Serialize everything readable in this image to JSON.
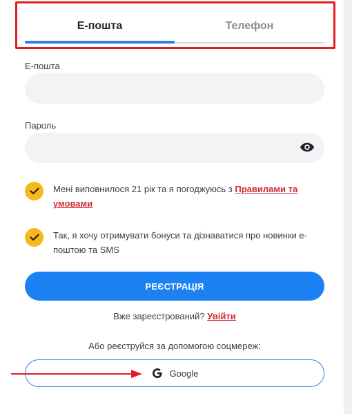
{
  "tabs": {
    "email_label": "Е-пошта",
    "phone_label": "Телефон",
    "active": "email"
  },
  "form": {
    "email_label": "Е-пошта",
    "email_value": "",
    "password_label": "Пароль",
    "password_value": "",
    "password_toggle_icon": "eye-icon"
  },
  "consents": [
    {
      "checked": true,
      "text": "Мені виповнилося 21 рік та я погоджуюсь з ",
      "link": "Правилами та умовами"
    },
    {
      "checked": true,
      "text": "Так, я хочу отримувати бонуси та дізнаватися про новинки е-поштою та SMS"
    }
  ],
  "register_button": "РЕЄСТРАЦІЯ",
  "login": {
    "prompt": "Вже зареєстрований? ",
    "link": "Увійти"
  },
  "social": {
    "prompt": "Або реєструйся за допомогою соцмереж:",
    "google_label": "Google",
    "google_icon": "google-g-icon"
  },
  "colors": {
    "accent": "#1c82f4",
    "checkbox": "#f6b91b",
    "link": "#cf2b33",
    "annotation": "#e31c23"
  }
}
